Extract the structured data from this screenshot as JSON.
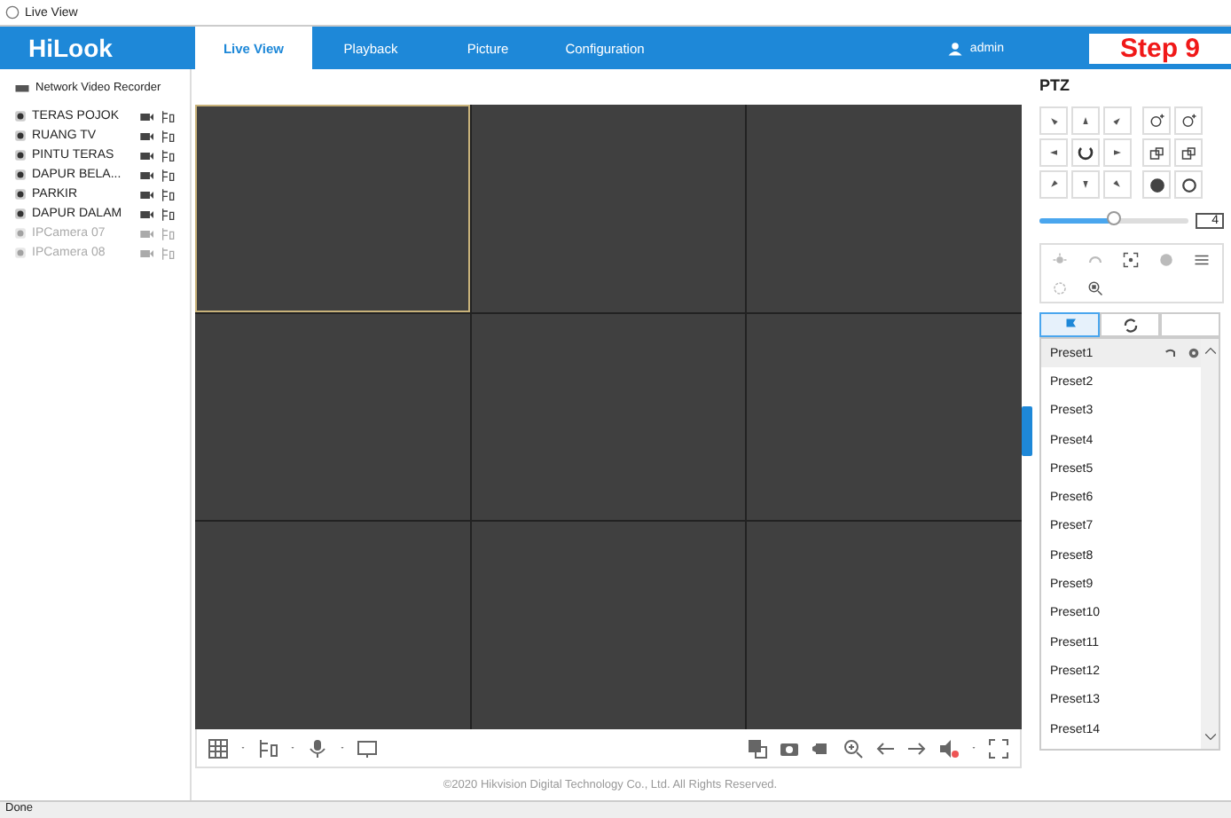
{
  "window": {
    "title": "Live View"
  },
  "header": {
    "logo": "HiLook",
    "user": "admin",
    "step_label": "Step 9"
  },
  "tabs": [
    {
      "label": "Live View",
      "selected": true
    },
    {
      "label": "Playback",
      "selected": false
    },
    {
      "label": "Picture",
      "selected": false
    },
    {
      "label": "Configuration",
      "selected": false
    }
  ],
  "device_tree": {
    "root": "Network Video Recorder",
    "cameras": [
      {
        "name": "TERAS POJOK",
        "online": true
      },
      {
        "name": "RUANG TV",
        "online": true
      },
      {
        "name": "PINTU TERAS",
        "online": true
      },
      {
        "name": "DAPUR BELA...",
        "online": true
      },
      {
        "name": "PARKIR",
        "online": true
      },
      {
        "name": "DAPUR DALAM",
        "online": true
      },
      {
        "name": "IPCamera 07",
        "online": false
      },
      {
        "name": "IPCamera 08",
        "online": false
      }
    ]
  },
  "video_grid": [
    {
      "selected": true
    },
    {
      "selected": false
    },
    {
      "selected": false
    },
    {
      "selected": false
    },
    {
      "selected": false
    },
    {
      "selected": false
    },
    {
      "selected": false
    },
    {
      "selected": false
    },
    {
      "selected": false
    }
  ],
  "ptz": {
    "title": "PTZ",
    "speed": {
      "level": 0.5,
      "value": "4"
    },
    "preset_tabs": [
      {
        "selected": true
      },
      {
        "selected": false
      },
      {
        "selected": false
      }
    ],
    "presets": [
      {
        "name": "Preset1",
        "selected": true
      },
      {
        "name": "Preset2",
        "selected": false
      },
      {
        "name": "Preset3",
        "selected": false
      },
      {
        "name": "Preset4",
        "selected": false
      },
      {
        "name": "Preset5",
        "selected": false
      },
      {
        "name": "Preset6",
        "selected": false
      },
      {
        "name": "Preset7",
        "selected": false
      },
      {
        "name": "Preset8",
        "selected": false
      },
      {
        "name": "Preset9",
        "selected": false
      },
      {
        "name": "Preset10",
        "selected": false
      },
      {
        "name": "Preset11",
        "selected": false
      },
      {
        "name": "Preset12",
        "selected": false
      },
      {
        "name": "Preset13",
        "selected": false
      },
      {
        "name": "Preset14",
        "selected": false
      }
    ]
  },
  "footer": {
    "copyright": "©2020 Hikvision Digital Technology Co., Ltd. All Rights Reserved."
  },
  "status_bar": {
    "text": "Done"
  }
}
